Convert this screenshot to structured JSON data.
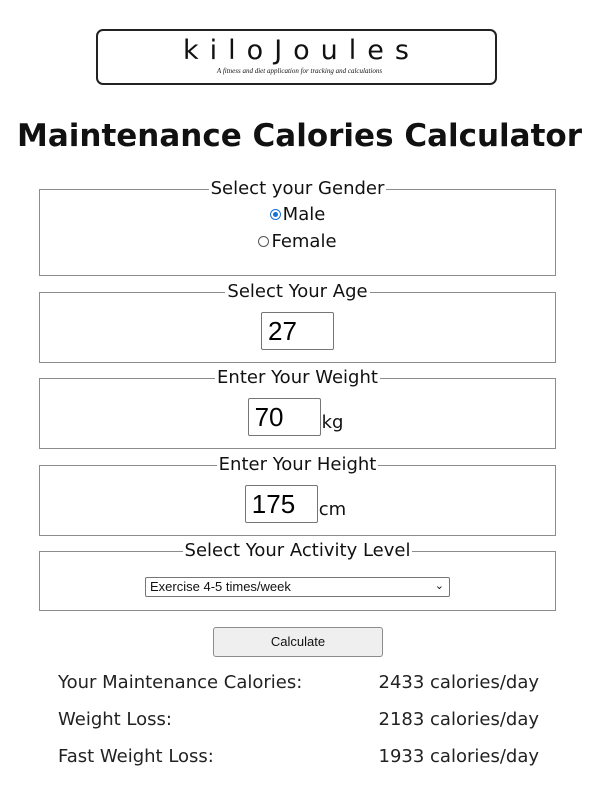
{
  "logo": {
    "title": "kiloJoules",
    "tagline": "A fitness and diet application for tracking and calculations"
  },
  "page_title": "Maintenance Calories Calculator",
  "gender": {
    "legend": "Select your Gender",
    "options": [
      "Male",
      "Female"
    ],
    "selected": "Male"
  },
  "age": {
    "legend": "Select Your Age",
    "value": "27"
  },
  "weight": {
    "legend": "Enter Your Weight",
    "value": "70",
    "unit": "kg"
  },
  "height": {
    "legend": "Enter Your Height",
    "value": "175",
    "unit": "cm"
  },
  "activity": {
    "legend": "Select Your Activity Level",
    "selected": "Exercise 4-5 times/week"
  },
  "calculate_label": "Calculate",
  "results": [
    {
      "label": "Your Maintenance Calories:",
      "value": "2433 calories/day"
    },
    {
      "label": "Weight Loss:",
      "value": "2183 calories/day"
    },
    {
      "label": "Fast Weight Loss:",
      "value": "1933 calories/day"
    }
  ],
  "colors": {
    "radio_accent": "#1a6fd6",
    "border": "#8c8c8c",
    "button_bg": "#efefef"
  },
  "icons": {
    "select_arrow": "chevron-down-icon"
  }
}
